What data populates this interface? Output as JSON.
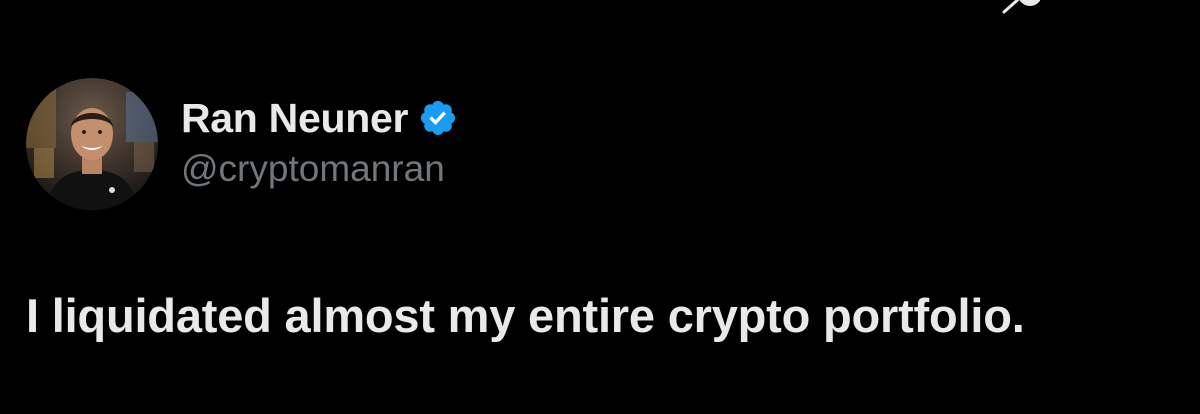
{
  "author": {
    "display_name": "Ran Neuner",
    "handle": "@cryptomanran",
    "verified": true,
    "avatar_icon": "profile-photo"
  },
  "tweet": {
    "text": "I liquidated almost my entire crypto portfolio."
  },
  "colors": {
    "background": "#000000",
    "primary_text": "#e7e9ea",
    "secondary_text": "#71767b",
    "verified_blue": "#1d9bf0"
  },
  "icons": {
    "verified": "verified-badge-icon",
    "top_corner": "partial-top-icon"
  }
}
